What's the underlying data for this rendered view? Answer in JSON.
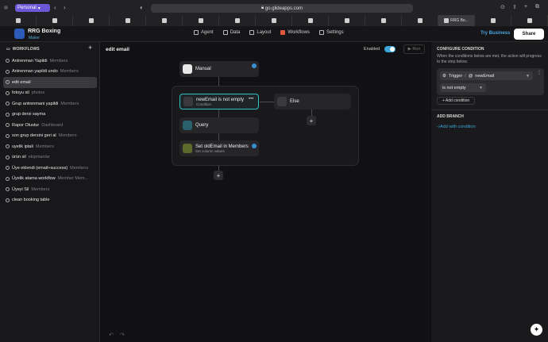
{
  "browser": {
    "profile_label": "Personal",
    "url": "go.glideapps.com",
    "active_tab_label": "RRG Bo..."
  },
  "app": {
    "name": "RRG Boxing",
    "role": "Maker",
    "nav": [
      "Agent",
      "Data",
      "Layout",
      "Workflows",
      "Settings"
    ],
    "try_label": "Try Business",
    "share_label": "Share"
  },
  "sidebar": {
    "title": "WORKFLOWS",
    "items": [
      {
        "name": "Antrenman Yapildi",
        "table": "Members"
      },
      {
        "name": "Antrenman yapildi undo",
        "table": "Members"
      },
      {
        "name": "edit email",
        "table": ""
      },
      {
        "name": "fotoyu sil",
        "table": "photos"
      },
      {
        "name": "Grup antrenmani yapildi",
        "table": "Members"
      },
      {
        "name": "grup dersi sayma",
        "table": ""
      },
      {
        "name": "Rapor Olustur",
        "table": "Dashboard"
      },
      {
        "name": "son grup dersini geri al",
        "table": "Members"
      },
      {
        "name": "uyelik iptali",
        "table": "Members"
      },
      {
        "name": "ürün sil",
        "table": "ekipmanlar"
      },
      {
        "name": "Üye eklendi (email+success)",
        "table": "Members"
      },
      {
        "name": "Üyelik atama workflow",
        "table": "Member Mem..."
      },
      {
        "name": "Üyeyi Sil",
        "table": "Members"
      },
      {
        "name": "clean booking table",
        "table": ""
      }
    ]
  },
  "canvas": {
    "title": "edit email",
    "enabled_label": "Enabled",
    "run_label": "Run",
    "trigger_node": "Manual",
    "condition_node": {
      "label": "newEmail is not empty",
      "sub": "Condition"
    },
    "else_node": "Else",
    "query_node": "Query",
    "set_node": {
      "label": "Set oldEmail in Members",
      "sub": "Set column values"
    }
  },
  "panel": {
    "title": "CONFIGURE CONDITION",
    "description": "When the conditions below are met, the action will progress to the step below.",
    "trigger_label": "Trigger",
    "separator": "/",
    "field": "newEmail",
    "operator": "is not empty",
    "add_condition": "+ Add condition",
    "add_branch_title": "ADD BRANCH",
    "add_with_condition": "Add with condition"
  },
  "icons": [
    "lightning-icon",
    "plus-icon",
    "check-icon",
    "else-icon",
    "query-icon",
    "set-icon",
    "undo-icon",
    "redo-icon",
    "sparkle-icon"
  ]
}
